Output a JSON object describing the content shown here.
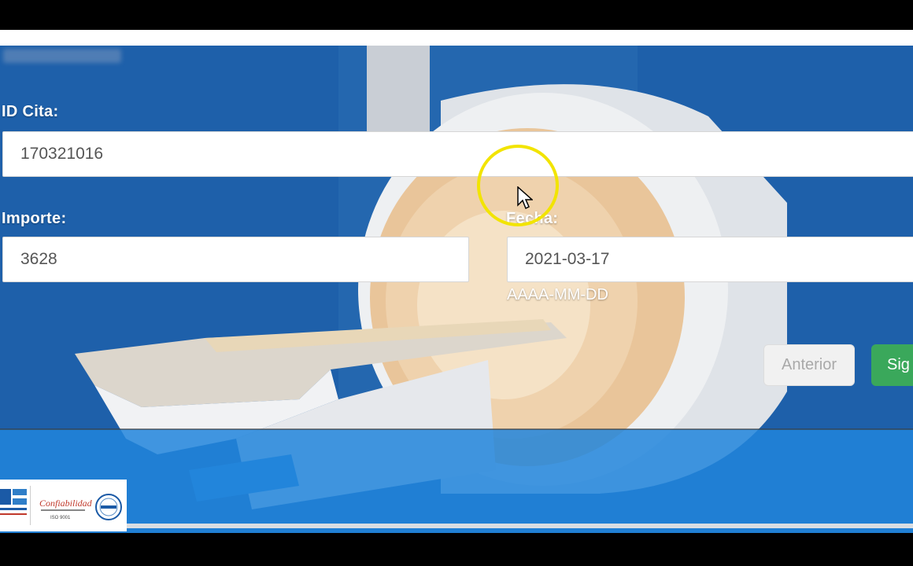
{
  "form": {
    "id_cita_label": "ID Cita:",
    "id_cita_value": "170321016",
    "importe_label": "Importe:",
    "importe_value": "3628",
    "fecha_label": "Fecha:",
    "fecha_value": "2021-03-17",
    "fecha_hint": "AAAA-MM-DD"
  },
  "buttons": {
    "prev_label": "Anterior",
    "next_label": "Sig"
  },
  "footer": {
    "certification": "Confiabilidad",
    "iso": "ISO 9001"
  },
  "colors": {
    "background_blue": "#1f63ac",
    "next_button": "#3aa85b",
    "cursor_highlight": "#f2e400"
  },
  "icons": {
    "cursor": "mouse-pointer-icon"
  }
}
